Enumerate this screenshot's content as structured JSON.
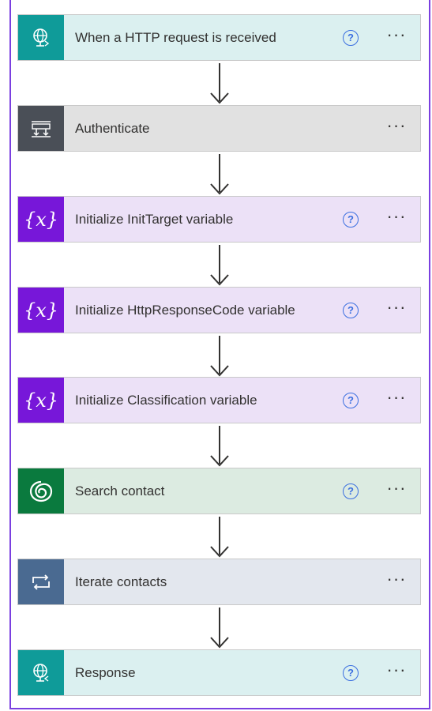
{
  "steps": [
    {
      "title": "When a HTTP request is received",
      "icon": "http-request-icon",
      "help": "?",
      "more": "···",
      "color": "#0f9b99",
      "bg": "#dbf0f0"
    },
    {
      "title": "Authenticate",
      "icon": "scope-icon",
      "more": "···",
      "color": "#4a4f57",
      "bg": "#e1e1e1"
    },
    {
      "title": "Initialize InitTarget variable",
      "icon": "variable-icon",
      "icon_text": "{x}",
      "help": "?",
      "more": "···",
      "color": "#7717d9",
      "bg": "#ece1f7"
    },
    {
      "title": "Initialize HttpResponseCode variable",
      "icon": "variable-icon",
      "icon_text": "{x}",
      "help": "?",
      "more": "···",
      "color": "#7717d9",
      "bg": "#ece1f7"
    },
    {
      "title": "Initialize Classification variable",
      "icon": "variable-icon",
      "icon_text": "{x}",
      "help": "?",
      "more": "···",
      "color": "#7717d9",
      "bg": "#ece1f7"
    },
    {
      "title": "Search contact",
      "icon": "dataverse-icon",
      "help": "?",
      "more": "···",
      "color": "#0a7a3e",
      "bg": "#dcebe1"
    },
    {
      "title": "Iterate contacts",
      "icon": "loop-icon",
      "more": "···",
      "color": "#4a6a91",
      "bg": "#e3e7ee"
    },
    {
      "title": "Response",
      "icon": "http-response-icon",
      "help": "?",
      "more": "···",
      "color": "#0f9b99",
      "bg": "#dbf0f0"
    }
  ]
}
